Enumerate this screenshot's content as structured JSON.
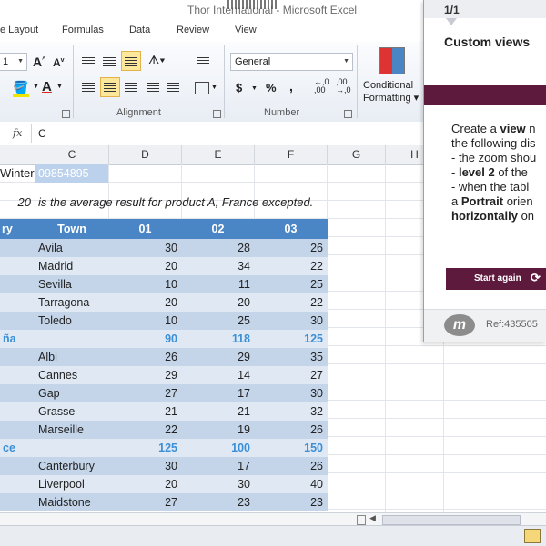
{
  "window": {
    "title": "Thor International - Microsoft Excel"
  },
  "tabs": [
    "e Layout",
    "Formulas",
    "Data",
    "Review",
    "View"
  ],
  "ribbon": {
    "font_size": "1",
    "number_format": "General",
    "currency_symbol": "$",
    "percent_symbol": "%",
    "comma_symbol": ",",
    "increase_decimal": ",00",
    "decrease_decimal": ",00",
    "cond_format_line1": "Conditional",
    "cond_format_line2": "Formatting",
    "groups": {
      "alignment": "Alignment",
      "number": "Number"
    }
  },
  "formula_bar": {
    "fx": "fx",
    "value": "C"
  },
  "columns": [
    "C",
    "D",
    "E",
    "F",
    "G",
    "H"
  ],
  "sheet": {
    "row1": {
      "label": "Winter",
      "code": "09854895"
    },
    "note": {
      "value": "20",
      "text": "is the average result for product A, France excepted."
    },
    "header": {
      "country": "ry",
      "town": "Town",
      "m1": "01",
      "m2": "02",
      "m3": "03"
    },
    "rows": [
      {
        "type": "data",
        "town": "Avila",
        "v": [
          "30",
          "28",
          "26"
        ]
      },
      {
        "type": "data",
        "town": "Madrid",
        "v": [
          "20",
          "34",
          "22"
        ]
      },
      {
        "type": "data",
        "town": "Sevilla",
        "v": [
          "10",
          "11",
          "25"
        ]
      },
      {
        "type": "data",
        "town": "Tarragona",
        "v": [
          "20",
          "20",
          "22"
        ]
      },
      {
        "type": "data",
        "town": "Toledo",
        "v": [
          "10",
          "25",
          "30"
        ]
      },
      {
        "type": "subtotal",
        "country": "ña",
        "town": "",
        "v": [
          "90",
          "118",
          "125"
        ]
      },
      {
        "type": "data",
        "town": "Albi",
        "v": [
          "26",
          "29",
          "35"
        ]
      },
      {
        "type": "data",
        "town": "Cannes",
        "v": [
          "29",
          "14",
          "27"
        ]
      },
      {
        "type": "data",
        "town": "Gap",
        "v": [
          "27",
          "17",
          "30"
        ]
      },
      {
        "type": "data",
        "town": "Grasse",
        "v": [
          "21",
          "21",
          "32"
        ]
      },
      {
        "type": "data",
        "town": "Marseille",
        "v": [
          "22",
          "19",
          "26"
        ]
      },
      {
        "type": "subtotal",
        "country": "ce",
        "town": "",
        "v": [
          "125",
          "100",
          "150"
        ]
      },
      {
        "type": "data",
        "town": "Canterbury",
        "v": [
          "30",
          "17",
          "26"
        ]
      },
      {
        "type": "data",
        "town": "Liverpool",
        "v": [
          "20",
          "30",
          "40"
        ]
      },
      {
        "type": "data",
        "town": "Maidstone",
        "v": [
          "27",
          "23",
          "23"
        ]
      }
    ]
  },
  "panel": {
    "page": "1/1",
    "title": "Custom views",
    "lines": [
      [
        "Create a ",
        "view",
        " n"
      ],
      [
        "the following dis",
        "",
        ""
      ],
      [
        "- the zoom shou",
        "",
        ""
      ],
      [
        "- ",
        "level 2",
        " of the"
      ],
      [
        "- when the tabl",
        "",
        ""
      ],
      [
        "a ",
        "Portrait",
        " orien"
      ],
      [
        "",
        "horizontally",
        " on"
      ]
    ],
    "start_button": "Start again",
    "ref": "Ref:435505"
  },
  "colors": {
    "header_bg": "#4a86c5",
    "row_bg_light": "#dfe8f3",
    "row_bg_mid": "#c4d5ea",
    "subtotal_text": "#3b8fd6",
    "panel_accent": "#5e1a3c",
    "selected_cell_bg": "#bcd2ec"
  }
}
